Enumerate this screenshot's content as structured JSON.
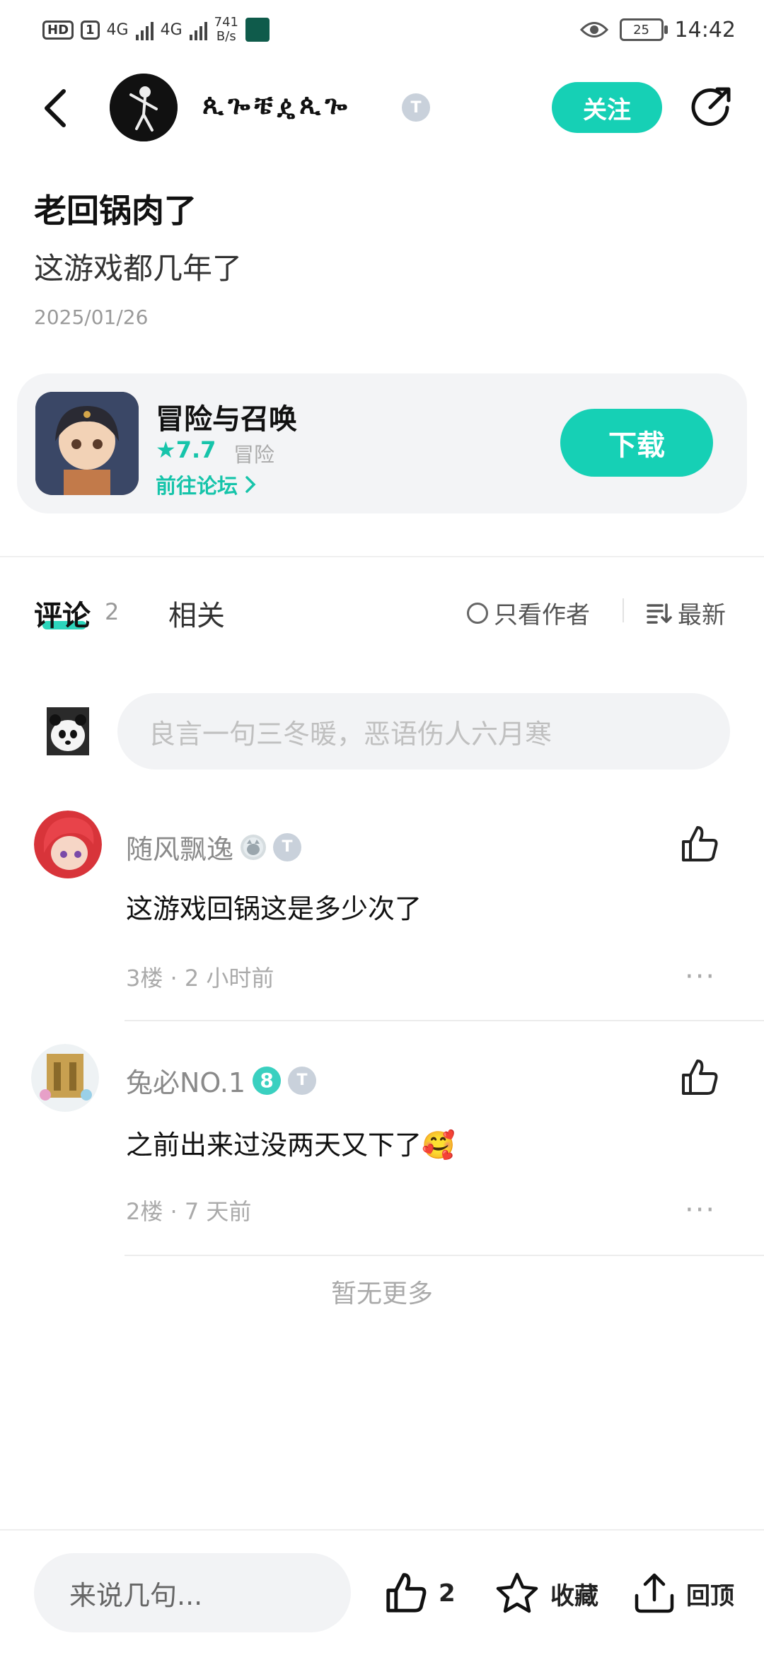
{
  "status_bar": {
    "hd": "HD",
    "sim": "1",
    "net1": "4G",
    "net2": "4G",
    "speed_value": "741",
    "speed_unit": "B/s",
    "battery": "25",
    "time": "14:42"
  },
  "header": {
    "username": "ጲጐቼዼጲጐ",
    "user_badge": "T",
    "follow_label": "关注"
  },
  "post": {
    "title": "老回锅肉了",
    "body": "这游戏都几年了",
    "date": "2025/01/26"
  },
  "game_card": {
    "name": "冒险与召唤",
    "rating": "★7.7",
    "category": "冒险",
    "forum_link": "前往论坛",
    "download_label": "下载"
  },
  "tabs": {
    "comments_label": "评论",
    "comments_count": "2",
    "related_label": "相关",
    "author_only": "只看作者",
    "sort_label": "最新"
  },
  "comment_input": {
    "placeholder": "良言一句三冬暖，恶语伤人六月寒"
  },
  "comments": [
    {
      "name": "随风飘逸",
      "badge": "T",
      "text": "这游戏回锅这是多少次了",
      "meta": "3楼 · 2 小时前",
      "more": "···"
    },
    {
      "name": "兔必NO.1",
      "level_badge": "8",
      "badge": "T",
      "text": "之前出来过没两天又下了🥰",
      "meta": "2楼 · 7 天前",
      "more": "···"
    }
  ],
  "no_more": "暂无更多",
  "bottom_bar": {
    "say_placeholder": "来说几句...",
    "like_count": "2",
    "collect_label": "收藏",
    "top_label": "回顶"
  },
  "colors": {
    "accent": "#16d0b5",
    "background": "#ffffff",
    "card": "#f3f4f6"
  }
}
